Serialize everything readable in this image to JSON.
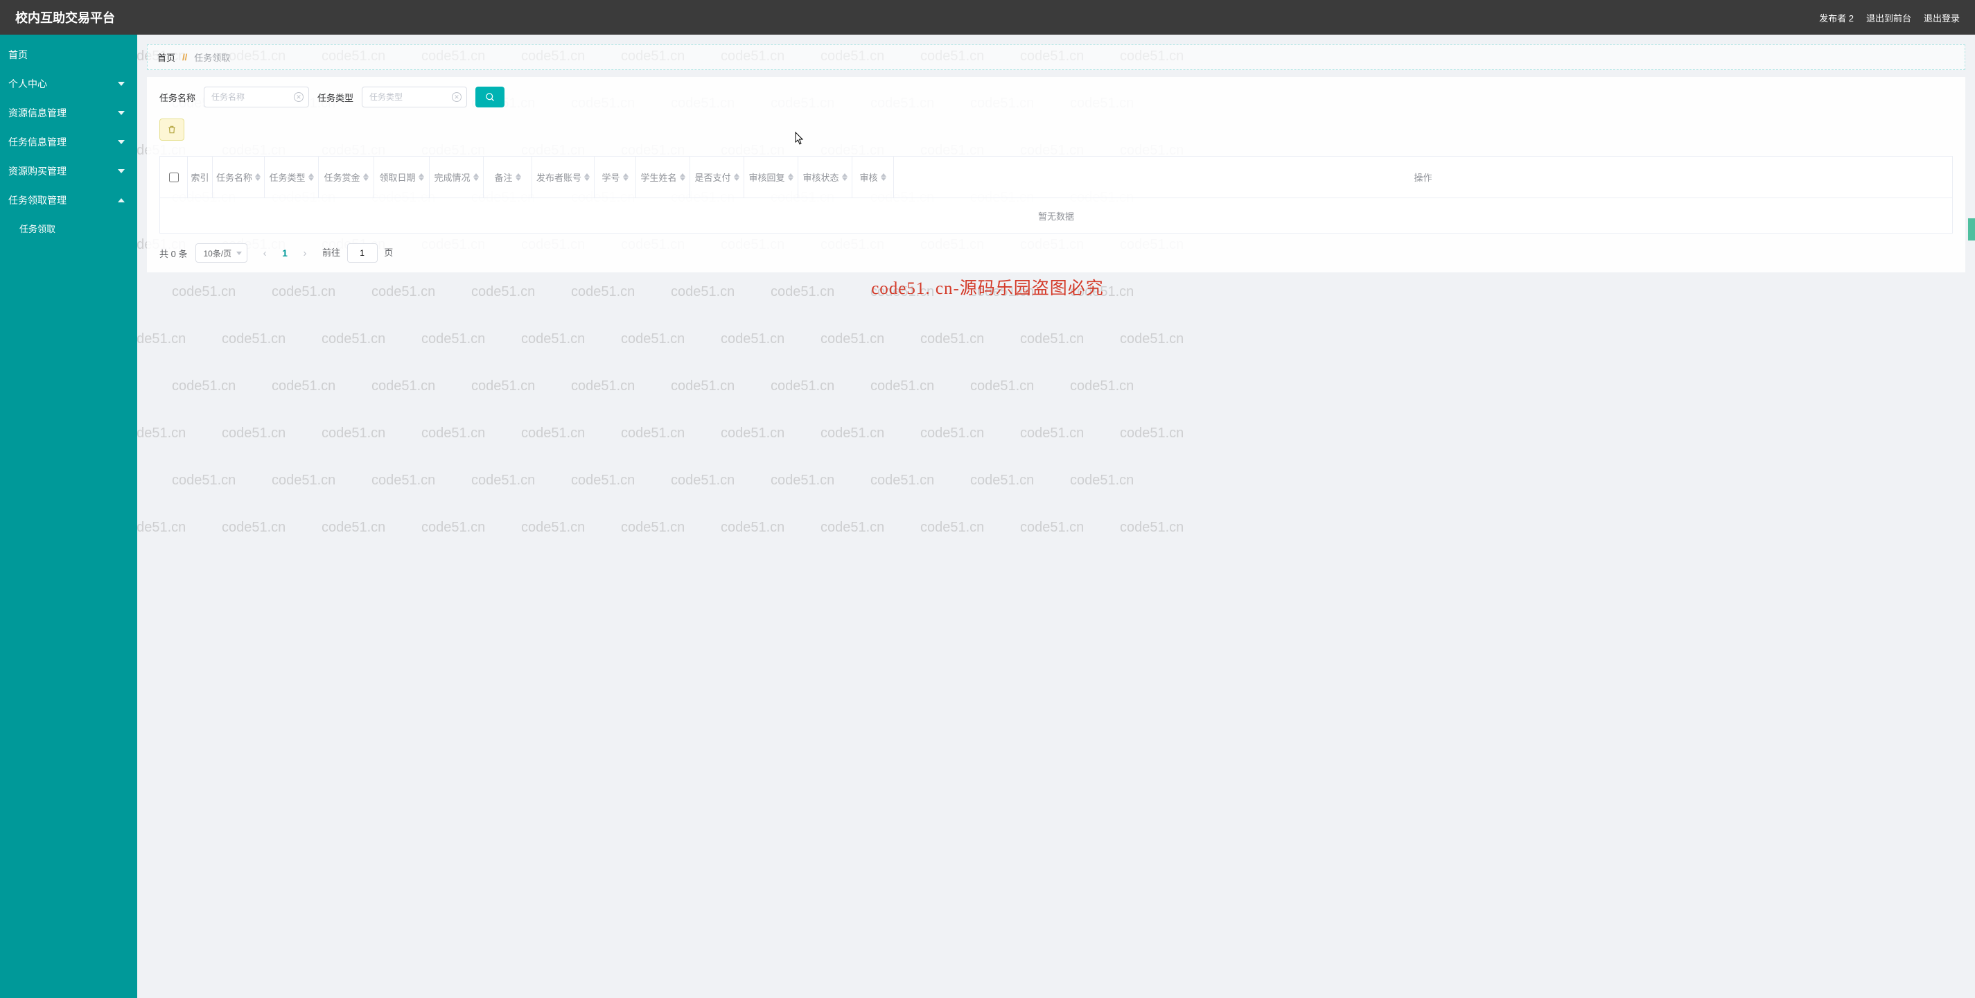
{
  "watermark_text": "code51.cn",
  "header": {
    "title": "校内互助交易平台",
    "user_label": "发布者 2",
    "exit_front": "退出到前台",
    "logout": "退出登录"
  },
  "sidebar": {
    "items": [
      {
        "label": "首页",
        "arrow": ""
      },
      {
        "label": "个人中心",
        "arrow": "down"
      },
      {
        "label": "资源信息管理",
        "arrow": "down"
      },
      {
        "label": "任务信息管理",
        "arrow": "down"
      },
      {
        "label": "资源购买管理",
        "arrow": "down"
      },
      {
        "label": "任务领取管理",
        "arrow": "up"
      }
    ],
    "sub_item": "任务领取"
  },
  "breadcrumb": {
    "home": "首页",
    "sep": "//",
    "current": "任务领取"
  },
  "search": {
    "name_label": "任务名称",
    "name_placeholder": "任务名称",
    "type_label": "任务类型",
    "type_placeholder": "任务类型"
  },
  "table": {
    "columns": {
      "index": "索引",
      "name": "任务名称",
      "type": "任务类型",
      "reward": "任务赏金",
      "date": "领取日期",
      "status": "完成情况",
      "remark": "备注",
      "publisher": "发布者账号",
      "sno": "学号",
      "sname": "学生姓名",
      "pay": "是否支付",
      "reply": "审核回复",
      "astatus": "审核状态",
      "audit": "审核",
      "op": "操作"
    },
    "empty": "暂无数据"
  },
  "pagination": {
    "total_text": "共 0 条",
    "page_size": "10条/页",
    "current": "1",
    "jump_prefix": "前往",
    "jump_value": "1",
    "jump_suffix": "页"
  },
  "center_text": "code51. cn-源码乐园盗图必究"
}
